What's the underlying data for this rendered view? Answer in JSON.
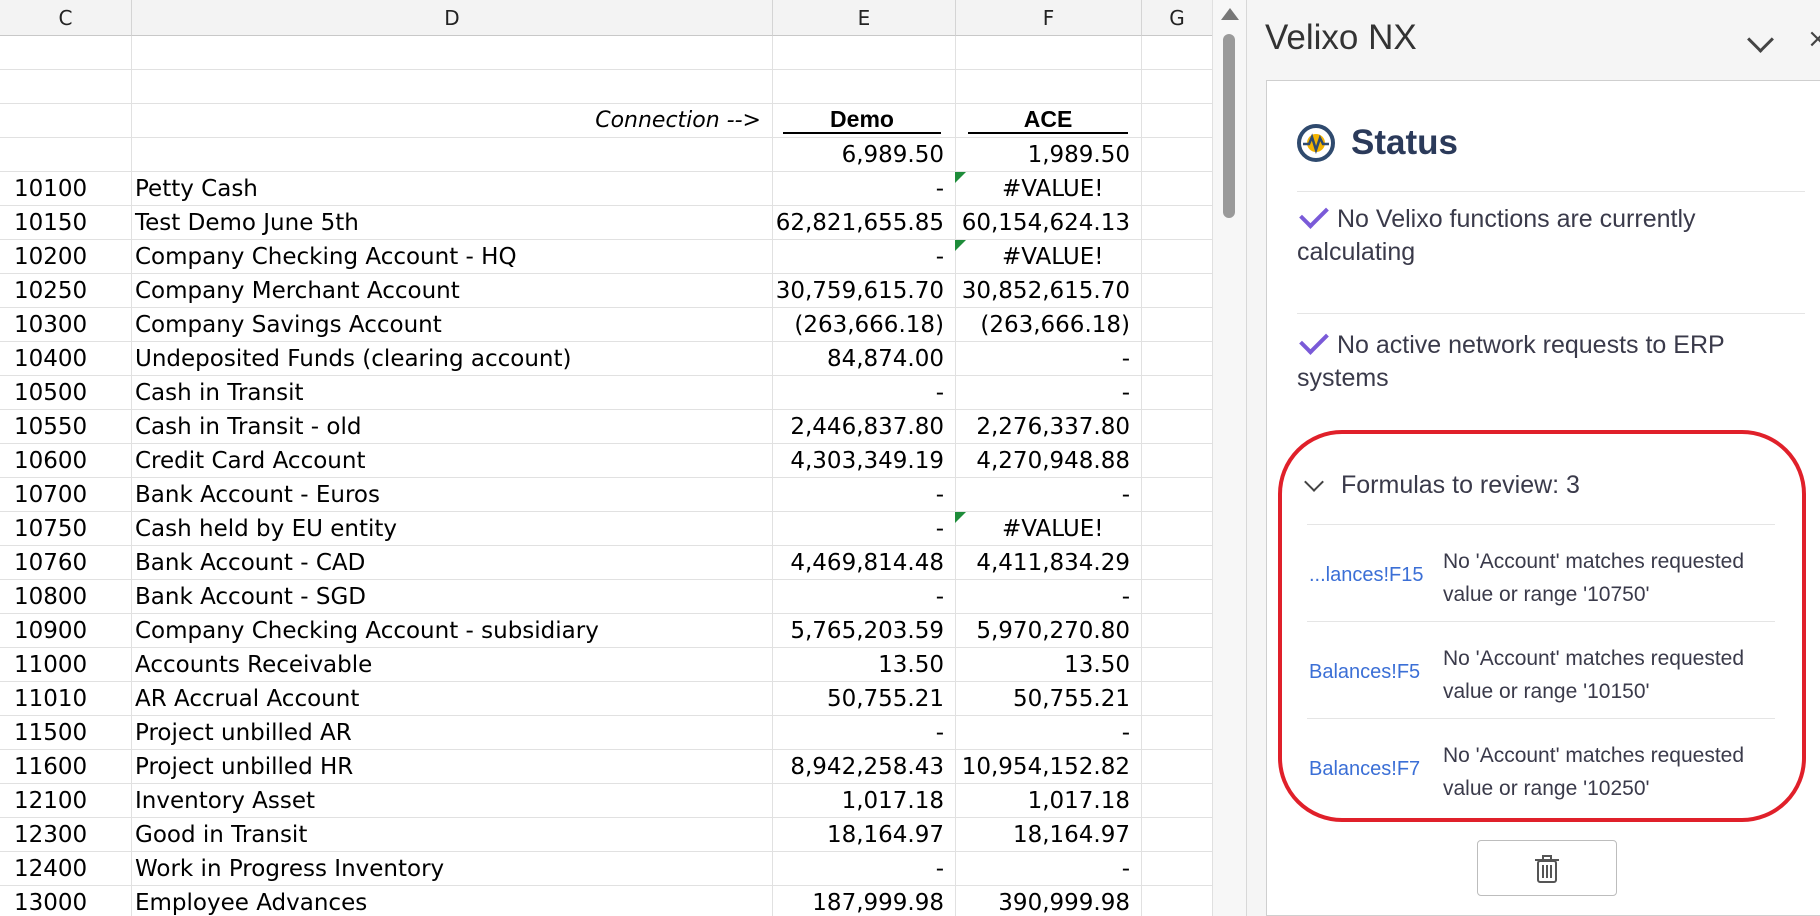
{
  "columns": [
    "C",
    "D",
    "E",
    "F",
    "G"
  ],
  "connection_label": "Connection -->",
  "header_e": "Demo",
  "header_f": "ACE",
  "totals": {
    "e": "6,989.50",
    "f": "1,989.50"
  },
  "rows": [
    {
      "code": "10100",
      "name": "Petty Cash",
      "e": "-",
      "f": "#VALUE!",
      "flag": true
    },
    {
      "code": "10150",
      "name": "Test Demo June 5th",
      "e": "62,821,655.85",
      "f": "60,154,624.13",
      "flag": false
    },
    {
      "code": "10200",
      "name": "Company Checking Account - HQ",
      "e": "-",
      "f": "#VALUE!",
      "flag": true
    },
    {
      "code": "10250",
      "name": "Company Merchant Account",
      "e": "30,759,615.70",
      "f": "30,852,615.70",
      "flag": false
    },
    {
      "code": "10300",
      "name": "Company Savings Account",
      "e": "(263,666.18)",
      "f": "(263,666.18)",
      "flag": false
    },
    {
      "code": "10400",
      "name": "Undeposited Funds (clearing account)",
      "e": "84,874.00",
      "f": "-",
      "flag": false
    },
    {
      "code": "10500",
      "name": "Cash in Transit",
      "e": "-",
      "f": "-",
      "flag": false
    },
    {
      "code": "10550",
      "name": "Cash in Transit - old",
      "e": "2,446,837.80",
      "f": "2,276,337.80",
      "flag": false
    },
    {
      "code": "10600",
      "name": "Credit Card Account",
      "e": "4,303,349.19",
      "f": "4,270,948.88",
      "flag": false
    },
    {
      "code": "10700",
      "name": "Bank Account - Euros",
      "e": "-",
      "f": "-",
      "flag": false
    },
    {
      "code": "10750",
      "name": "Cash held by EU entity",
      "e": "-",
      "f": "#VALUE!",
      "flag": true
    },
    {
      "code": "10760",
      "name": "Bank Account - CAD",
      "e": "4,469,814.48",
      "f": "4,411,834.29",
      "flag": false
    },
    {
      "code": "10800",
      "name": "Bank Account - SGD",
      "e": "-",
      "f": "-",
      "flag": false
    },
    {
      "code": "10900",
      "name": "Company Checking Account - subsidiary",
      "e": "5,765,203.59",
      "f": "5,970,270.80",
      "flag": false
    },
    {
      "code": "11000",
      "name": "Accounts Receivable",
      "e": "13.50",
      "f": "13.50",
      "flag": false
    },
    {
      "code": "11010",
      "name": "AR Accrual Account",
      "e": "50,755.21",
      "f": "50,755.21",
      "flag": false
    },
    {
      "code": "11500",
      "name": "Project unbilled AR",
      "e": "-",
      "f": "-",
      "flag": false
    },
    {
      "code": "11600",
      "name": "Project unbilled HR",
      "e": "8,942,258.43",
      "f": "10,954,152.82",
      "flag": false
    },
    {
      "code": "12100",
      "name": "Inventory Asset",
      "e": "1,017.18",
      "f": "1,017.18",
      "flag": false
    },
    {
      "code": "12300",
      "name": "Good in Transit",
      "e": "18,164.97",
      "f": "18,164.97",
      "flag": false
    },
    {
      "code": "12400",
      "name": "Work in Progress Inventory",
      "e": "-",
      "f": "-",
      "flag": false
    },
    {
      "code": "13000",
      "name": "Employee Advances",
      "e": "187,999.98",
      "f": "390,999.98",
      "flag": false
    }
  ],
  "pane": {
    "title": "Velixo NX",
    "status_title": "Status",
    "msg1": "No Velixo functions are currently calculating",
    "msg2": "No active network requests to ERP systems",
    "review_label": "Formulas to review: 3",
    "review_items": [
      {
        "link": "...lances!F15",
        "text": "No 'Account' matches requested value or range '10750'"
      },
      {
        "link": "Balances!F5",
        "text": "No 'Account' matches requested value or range '10150'"
      },
      {
        "link": "Balances!F7",
        "text": "No 'Account' matches requested value or range '10250'"
      }
    ]
  },
  "colors": {
    "accent": "#7a5ad8",
    "link": "#3b6fd6",
    "highlight": "#e0202a",
    "error_flag": "#1e8c3a"
  },
  "icons": [
    "status-wave-icon",
    "check-icon",
    "chevron-down-icon",
    "trash-icon",
    "close-icon"
  ]
}
